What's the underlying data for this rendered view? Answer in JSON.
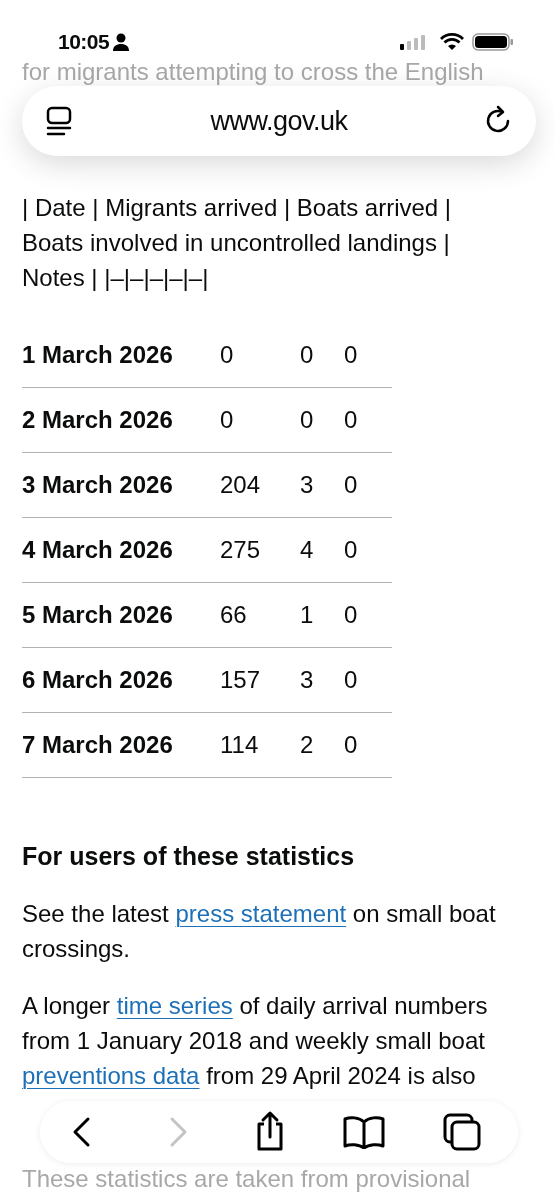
{
  "status_bar": {
    "time": "10:05"
  },
  "address_bar": {
    "url": "www.gov.uk"
  },
  "intro_lines": [
    "for migrants attempting to cross the English"
  ],
  "markdown_text": "| Date | Migrants arrived | Boats arrived | Boats involved in uncontrolled landings | Notes | |–|–|–|–|–|",
  "table": {
    "rows": [
      {
        "date": "1 March 2026",
        "migrants": "0",
        "boats": "0",
        "uncontrolled": "0"
      },
      {
        "date": "2 March 2026",
        "migrants": "0",
        "boats": "0",
        "uncontrolled": "0"
      },
      {
        "date": "3 March 2026",
        "migrants": "204",
        "boats": "3",
        "uncontrolled": "0"
      },
      {
        "date": "4 March 2026",
        "migrants": "275",
        "boats": "4",
        "uncontrolled": "0"
      },
      {
        "date": "5 March 2026",
        "migrants": "66",
        "boats": "1",
        "uncontrolled": "0"
      },
      {
        "date": "6 March 2026",
        "migrants": "157",
        "boats": "3",
        "uncontrolled": "0"
      },
      {
        "date": "7 March 2026",
        "migrants": "114",
        "boats": "2",
        "uncontrolled": "0"
      }
    ]
  },
  "section": {
    "heading": "For users of these statistics",
    "paragraphs": [
      [
        {
          "text": "See the latest "
        },
        {
          "text": "press statement",
          "link": true
        },
        {
          "text": " on small boat crossings."
        }
      ],
      [
        {
          "text": "A longer "
        },
        {
          "text": "time series",
          "link": true
        },
        {
          "text": " of daily arrival numbers from 1 January 2018 and weekly small boat "
        },
        {
          "text": "preventions data",
          "link": true
        },
        {
          "text": " from 29 April 2024 is also"
        }
      ]
    ],
    "faded_line": "These statistics are taken from provisional"
  },
  "toolbar": {
    "forward_disabled": true
  }
}
